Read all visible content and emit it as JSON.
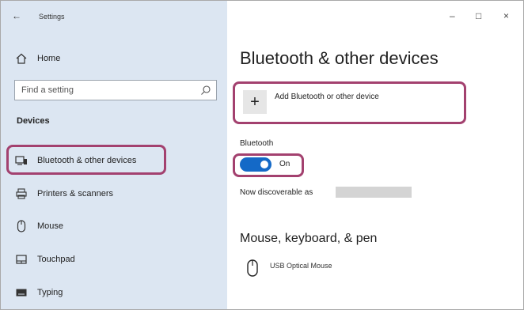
{
  "window": {
    "title": "Settings",
    "back_icon": "back-arrow-icon",
    "controls": {
      "minimize": "–",
      "maximize": "□",
      "close": "×"
    }
  },
  "sidebar": {
    "home_label": "Home",
    "search_placeholder": "Find a setting",
    "section_header": "Devices",
    "items": [
      {
        "label": "Bluetooth & other devices",
        "icon": "bluetooth-devices-icon",
        "selected": true
      },
      {
        "label": "Printers & scanners",
        "icon": "printer-icon"
      },
      {
        "label": "Mouse",
        "icon": "mouse-icon"
      },
      {
        "label": "Touchpad",
        "icon": "touchpad-icon"
      },
      {
        "label": "Typing",
        "icon": "keyboard-icon"
      }
    ]
  },
  "main": {
    "title": "Bluetooth & other devices",
    "add_device_label": "Add Bluetooth or other device",
    "bluetooth_label": "Bluetooth",
    "toggle_state": "On",
    "discoverable_text": "Now discoverable as",
    "section_title": "Mouse, keyboard, & pen",
    "device_name": "USB Optical Mouse"
  },
  "colors": {
    "sidebar_bg": "#dce6f2",
    "accent": "#1469c7",
    "highlight": "#a3416f"
  }
}
